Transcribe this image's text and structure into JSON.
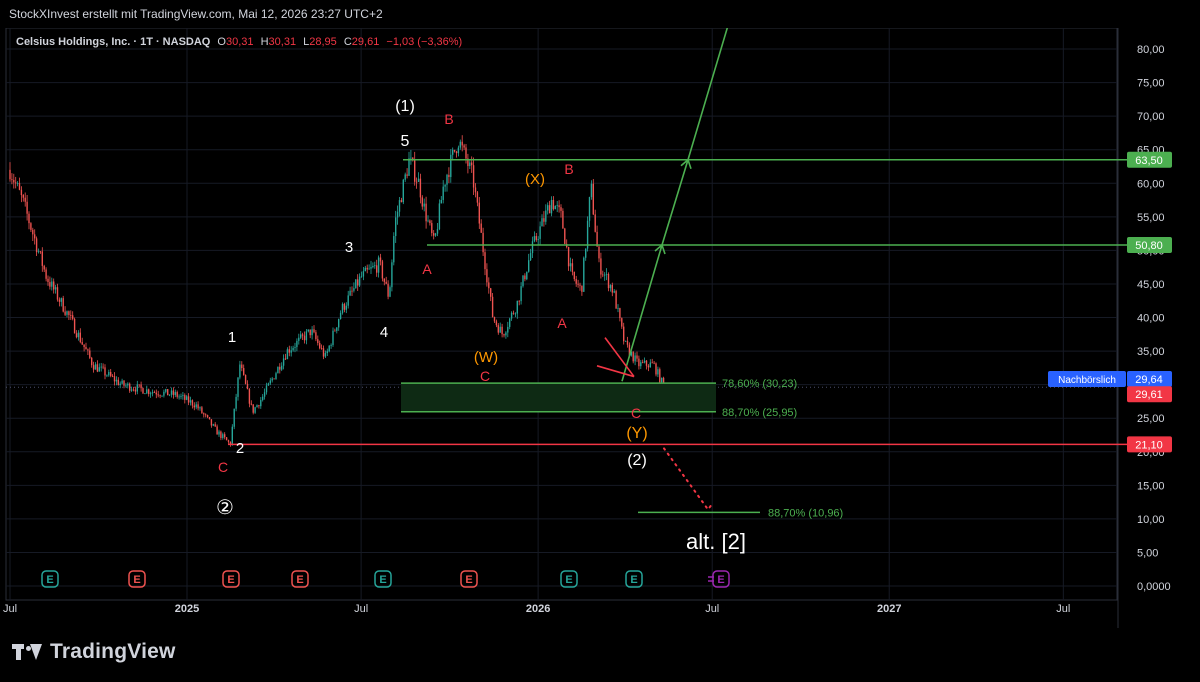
{
  "header": {
    "caption": "StockXInvest erstellt mit TradingView.com, Mai 12, 2026 23:27 UTC+2"
  },
  "legend": {
    "symbol": "Celsius Holdings, Inc. · 1T · NASDAQ",
    "o_label": "O",
    "o_value": "30,31",
    "h_label": "H",
    "h_value": "30,31",
    "l_label": "L",
    "l_value": "28,95",
    "c_label": "C",
    "c_value": "29,61",
    "change": "−1,03 (−3,36%)"
  },
  "brand": {
    "name": "TradingView"
  },
  "colors": {
    "background": "#000000",
    "up": "#26a69a",
    "down": "#ef5350",
    "green_line": "#4caf50",
    "red_line": "#f23645",
    "orange_label": "#ff9800",
    "blue_tag": "#2962ff",
    "purple_event": "#9c27b0",
    "zone_fill": "#0e2a14"
  },
  "chart_data": {
    "type": "candlestick",
    "title": "Celsius Holdings, Inc. · 1T · NASDAQ",
    "x_tick_labels": [
      "Jul",
      "2025",
      "Jul",
      "2026",
      "Jul",
      "2027",
      "Jul"
    ],
    "y_tick_labels": [
      "80,00",
      "75,00",
      "70,00",
      "65,00",
      "60,00",
      "55,00",
      "50,00",
      "45,00",
      "40,00",
      "35,00",
      "30,00",
      "25,00",
      "20,00",
      "15,00",
      "10,00",
      "5,00",
      "0,0000"
    ],
    "ylim": [
      0,
      82
    ],
    "grid": true,
    "price_path": [
      [
        "2024-07-01",
        62
      ],
      [
        "2024-07-15",
        57
      ],
      [
        "2024-08-08",
        46
      ],
      [
        "2024-09-01",
        40
      ],
      [
        "2024-09-25",
        33
      ],
      [
        "2024-10-25",
        30
      ],
      [
        "2024-11-25",
        29
      ],
      [
        "2024-12-20",
        28.5
      ],
      [
        "2025-01-10",
        27
      ],
      [
        "2025-02-01",
        23
      ],
      [
        "2025-02-15",
        21.1
      ],
      [
        "2025-02-25",
        33
      ],
      [
        "2025-03-10",
        26
      ],
      [
        "2025-03-20",
        28
      ],
      [
        "2025-04-15",
        35
      ],
      [
        "2025-05-10",
        38
      ],
      [
        "2025-05-25",
        34
      ],
      [
        "2025-06-10",
        41
      ],
      [
        "2025-07-01",
        46
      ],
      [
        "2025-07-20",
        48
      ],
      [
        "2025-07-30",
        43
      ],
      [
        "2025-08-05",
        54
      ],
      [
        "2025-08-20",
        63.5
      ],
      [
        "2025-08-30",
        60
      ],
      [
        "2025-09-05",
        56
      ],
      [
        "2025-09-15",
        50.8
      ],
      [
        "2025-09-25",
        60
      ],
      [
        "2025-10-10",
        66.5
      ],
      [
        "2025-10-25",
        61
      ],
      [
        "2025-11-05",
        50
      ],
      [
        "2025-11-15",
        40
      ],
      [
        "2025-11-25",
        37.5
      ],
      [
        "2025-12-10",
        42
      ],
      [
        "2025-12-25",
        50
      ],
      [
        "2026-01-15",
        57.5
      ],
      [
        "2026-01-25",
        55
      ],
      [
        "2026-02-05",
        46
      ],
      [
        "2026-02-15",
        44
      ],
      [
        "2026-02-25",
        59.5
      ],
      [
        "2026-03-05",
        48
      ],
      [
        "2026-03-20",
        44
      ],
      [
        "2026-04-01",
        36
      ],
      [
        "2026-04-15",
        33
      ],
      [
        "2026-05-01",
        33
      ],
      [
        "2026-05-12",
        29.61
      ]
    ],
    "horizontal_levels": [
      {
        "label": "63,50",
        "value": 63.5,
        "color": "#4caf50"
      },
      {
        "label": "50,80",
        "value": 50.8,
        "color": "#4caf50"
      },
      {
        "label": "21,10",
        "value": 21.1,
        "color": "#f23645"
      }
    ],
    "fib_levels": [
      {
        "label": "78,60% (30,23)",
        "value": 30.23
      },
      {
        "label": "88,70% (25,95)",
        "value": 25.95
      },
      {
        "label": "88,70% (10,96)",
        "value": 10.96
      }
    ],
    "price_tags": [
      {
        "label": "Nachbörslich",
        "value": "29,64",
        "color": "#2962ff"
      },
      {
        "label": "",
        "value": "29,61",
        "color": "#f23645"
      }
    ],
    "wave_labels": [
      {
        "text": "(1)",
        "color": "#ffffff"
      },
      {
        "text": "5",
        "color": "#ffffff"
      },
      {
        "text": "B",
        "color": "#f23645"
      },
      {
        "text": "(X)",
        "color": "#ff9800"
      },
      {
        "text": "B",
        "color": "#f23645"
      },
      {
        "text": "3",
        "color": "#ffffff"
      },
      {
        "text": "A",
        "color": "#f23645"
      },
      {
        "text": "4",
        "color": "#ffffff"
      },
      {
        "text": "1",
        "color": "#ffffff"
      },
      {
        "text": "A",
        "color": "#f23645"
      },
      {
        "text": "(W)",
        "color": "#ff9800"
      },
      {
        "text": "C",
        "color": "#f23645"
      },
      {
        "text": "C",
        "color": "#f23645"
      },
      {
        "text": "(Y)",
        "color": "#ff9800"
      },
      {
        "text": "(2)",
        "color": "#ffffff"
      },
      {
        "text": "2",
        "color": "#ffffff"
      },
      {
        "text": "C",
        "color": "#f23645"
      },
      {
        "text": "②",
        "color": "#ffffff"
      },
      {
        "text": "alt. [2]",
        "color": "#ffffff"
      }
    ],
    "event_markers": [
      {
        "text": "E",
        "color": "#26a69a"
      },
      {
        "text": "E",
        "color": "#ef5350"
      },
      {
        "text": "E",
        "color": "#ef5350"
      },
      {
        "text": "E",
        "color": "#ef5350"
      },
      {
        "text": "E",
        "color": "#26a69a"
      },
      {
        "text": "E",
        "color": "#ef5350"
      },
      {
        "text": "E",
        "color": "#26a69a"
      },
      {
        "text": "E",
        "color": "#26a69a"
      },
      {
        "text": "E",
        "color": "#9c27b0"
      }
    ]
  }
}
